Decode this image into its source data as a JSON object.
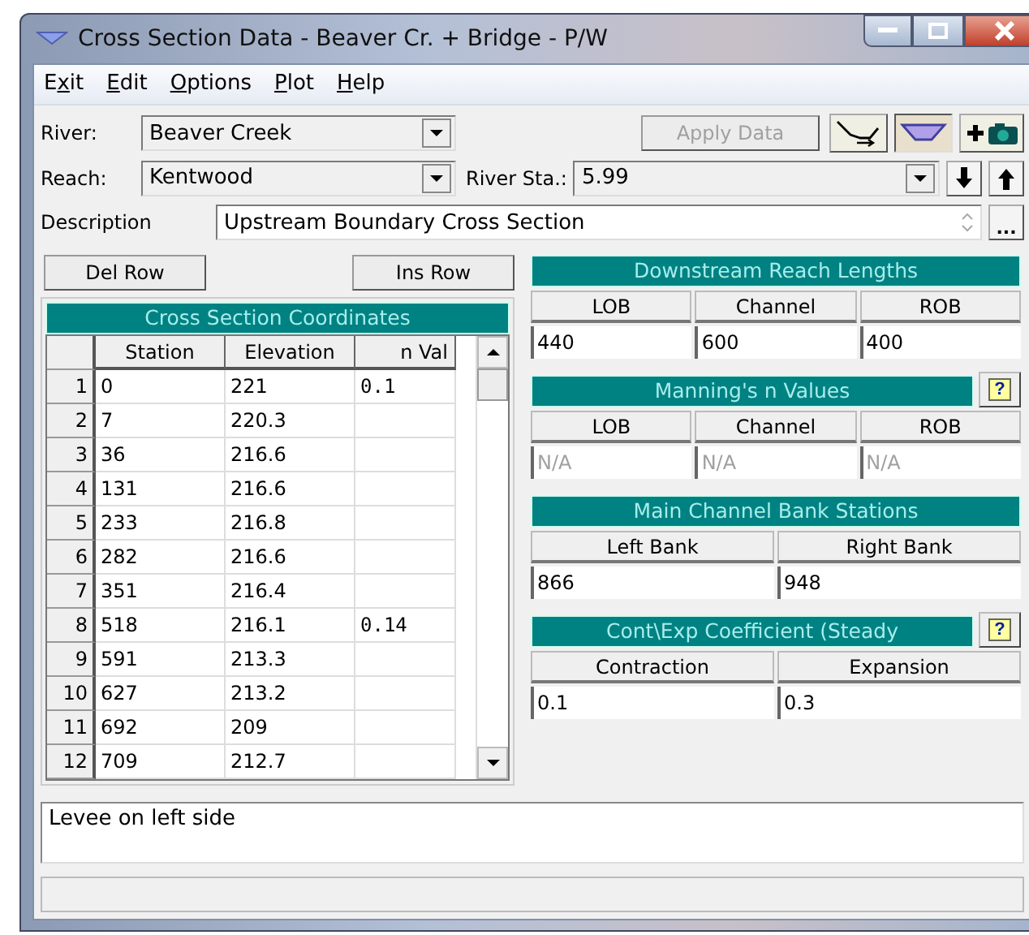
{
  "window": {
    "title": "Cross Section Data - Beaver Cr. + Bridge - P/W"
  },
  "menu": [
    {
      "pre": "E",
      "key": "x",
      "post": "it"
    },
    {
      "key": "E",
      "post": "dit"
    },
    {
      "key": "O",
      "post": "ptions"
    },
    {
      "key": "P",
      "post": "lot"
    },
    {
      "key": "H",
      "post": "elp"
    }
  ],
  "river": {
    "label": "River:",
    "value": "Beaver Creek"
  },
  "apply_button": {
    "label": "Apply Data",
    "disabled": true
  },
  "reach": {
    "label": "Reach:",
    "value": "Kentwood"
  },
  "river_station": {
    "label": "River Sta.:",
    "value": "5.99"
  },
  "description": {
    "label": "Description",
    "value": "Upstream Boundary Cross Section"
  },
  "more_button": {
    "label": "..."
  },
  "row_buttons": [
    "Del Row",
    "Ins Row"
  ],
  "coordinates": {
    "title": "Cross Section Coordinates",
    "columns": [
      "Station",
      "Elevation",
      "n Val"
    ],
    "rows": [
      {
        "row": "1",
        "station": "0",
        "elevation": "221",
        "n_val": "0.1"
      },
      {
        "row": "2",
        "station": "7",
        "elevation": "220.3",
        "n_val": ""
      },
      {
        "row": "3",
        "station": "36",
        "elevation": "216.6",
        "n_val": ""
      },
      {
        "row": "4",
        "station": "131",
        "elevation": "216.6",
        "n_val": ""
      },
      {
        "row": "5",
        "station": "233",
        "elevation": "216.8",
        "n_val": ""
      },
      {
        "row": "6",
        "station": "282",
        "elevation": "216.6",
        "n_val": ""
      },
      {
        "row": "7",
        "station": "351",
        "elevation": "216.4",
        "n_val": ""
      },
      {
        "row": "8",
        "station": "518",
        "elevation": "216.1",
        "n_val": "0.14"
      },
      {
        "row": "9",
        "station": "591",
        "elevation": "213.3",
        "n_val": ""
      },
      {
        "row": "10",
        "station": "627",
        "elevation": "213.2",
        "n_val": ""
      },
      {
        "row": "11",
        "station": "692",
        "elevation": "209",
        "n_val": ""
      },
      {
        "row": "12",
        "station": "709",
        "elevation": "212.7",
        "n_val": ""
      }
    ]
  },
  "panels": [
    {
      "title": "Downstream Reach Lengths",
      "disabled": false,
      "columns": [
        "LOB",
        "Channel",
        "ROB"
      ],
      "values": [
        "440",
        "600",
        "400"
      ]
    },
    {
      "title": "Manning's n Values",
      "help_button": "?",
      "disabled": true,
      "columns": [
        "LOB",
        "Channel",
        "ROB"
      ],
      "values": [
        "N/A",
        "N/A",
        "N/A"
      ]
    },
    {
      "title": "Main Channel Bank Stations",
      "disabled": false,
      "columns": [
        "Left Bank",
        "Right Bank"
      ],
      "values": [
        "866",
        "948"
      ]
    },
    {
      "title": "Cont\\Exp Coefficient (Steady",
      "help_button": "?",
      "disabled": false,
      "columns": [
        "Contraction",
        "Expansion"
      ],
      "values": [
        "0.1",
        "0.3"
      ]
    }
  ],
  "note": {
    "value": "Levee on left side"
  }
}
